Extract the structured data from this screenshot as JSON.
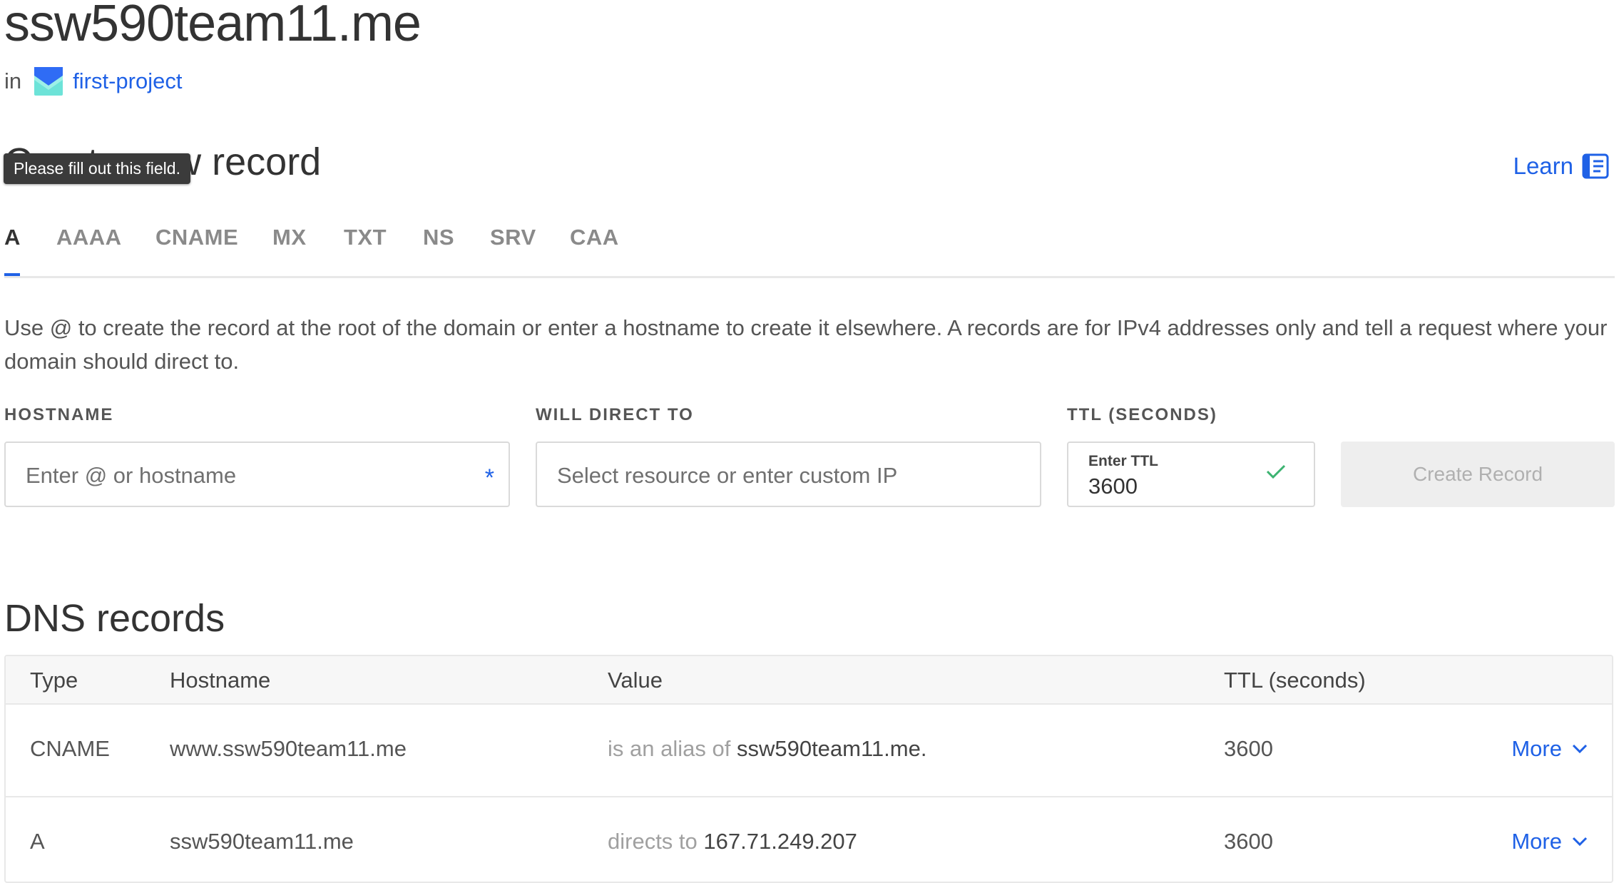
{
  "domain": {
    "title": "ssw590team11.me"
  },
  "project": {
    "prefix": "in",
    "name": "first-project"
  },
  "create_section": {
    "heading": "Create new record",
    "tooltip": "Please fill out this field.",
    "learn_label": "Learn"
  },
  "tabs": [
    {
      "label": "A",
      "active": true
    },
    {
      "label": "AAAA"
    },
    {
      "label": "CNAME"
    },
    {
      "label": "MX"
    },
    {
      "label": "TXT"
    },
    {
      "label": "NS"
    },
    {
      "label": "SRV"
    },
    {
      "label": "CAA"
    }
  ],
  "description": "Use @ to create the record at the root of the domain or enter a hostname to create it elsewhere. A records are for IPv4 addresses only and tell a request where your domain should direct to.",
  "form": {
    "hostname_label": "HOSTNAME",
    "hostname_placeholder": "Enter @ or hostname",
    "hostname_required": "*",
    "direct_label": "WILL DIRECT TO",
    "direct_placeholder": "Select resource or enter custom IP",
    "ttl_label": "TTL (SECONDS)",
    "ttl_small_label": "Enter TTL",
    "ttl_value": "3600",
    "create_button": "Create Record"
  },
  "dns": {
    "heading": "DNS records",
    "columns": [
      "Type",
      "Hostname",
      "Value",
      "TTL (seconds)"
    ],
    "rows": [
      {
        "type": "CNAME",
        "hostname": "www.ssw590team11.me",
        "value_prefix": "is an alias of",
        "value": "ssw590team11.me.",
        "ttl": "3600",
        "action": "More"
      },
      {
        "type": "A",
        "hostname": "ssw590team11.me",
        "value_prefix": "directs to",
        "value": "167.71.249.207",
        "ttl": "3600",
        "action": "More"
      }
    ]
  },
  "colors": {
    "accent": "#1f61e6",
    "success": "#3cb371",
    "tooltip_bg": "#3b3b3b"
  },
  "icons": [
    "project-logo-icon",
    "book-icon",
    "checkmark-icon",
    "chevron-down-icon"
  ]
}
